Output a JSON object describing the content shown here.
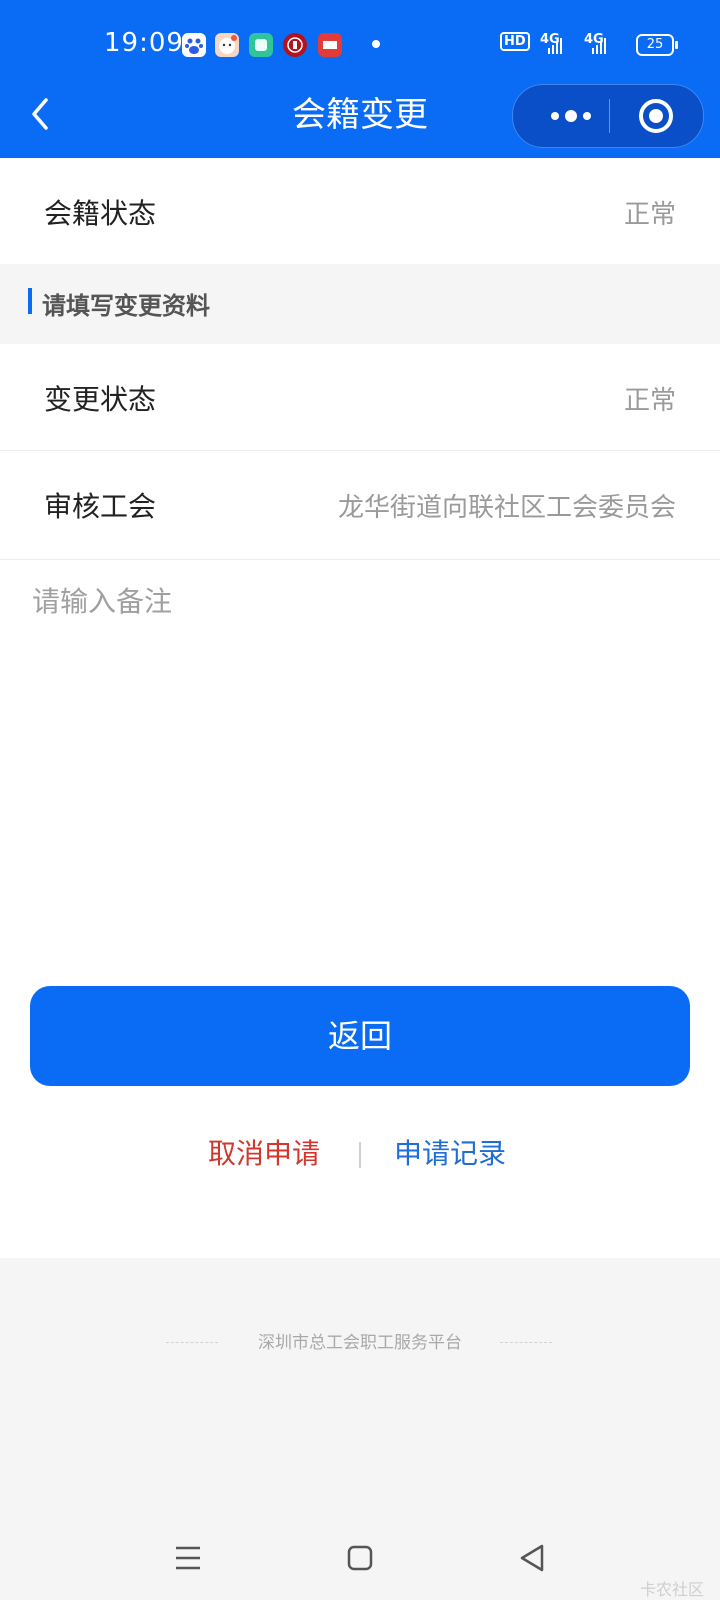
{
  "status_bar": {
    "time": "19:09",
    "battery": "25",
    "network_1": "4G",
    "network_2": "4G",
    "hd_badge": "HD",
    "notification_icons": [
      "baidu-icon",
      "cartoon-icon",
      "green-app-icon",
      "bank-icon",
      "toutiao-icon"
    ]
  },
  "header": {
    "title": "会籍变更",
    "back_icon": "chevron-left-icon",
    "more_icon": "more-dots-icon",
    "close_icon": "target-circle-icon",
    "bg_color": "#0a6cf5"
  },
  "membership": {
    "label": "会籍状态",
    "value": "正常"
  },
  "section": {
    "title": "请填写变更资料"
  },
  "form": {
    "change_status_label": "变更状态",
    "change_status_value": "正常",
    "review_union_label": "审核工会",
    "review_union_value": "龙华街道向联社区工会委员会",
    "remark_placeholder": "请输入备注",
    "remark_value": ""
  },
  "actions": {
    "return_label": "返回",
    "cancel_label": "取消申请",
    "records_label": "申请记录",
    "cancel_color": "#d2372d",
    "records_color": "#1f6dd6"
  },
  "footer": {
    "text": "深圳市总工会职工服务平台"
  },
  "watermark": {
    "text": "卡农社区"
  }
}
